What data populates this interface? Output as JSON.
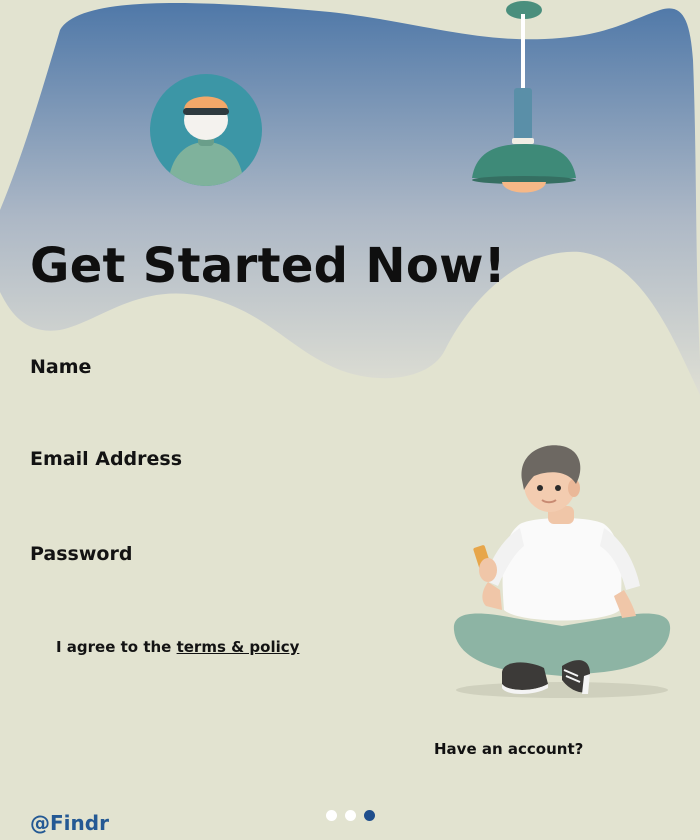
{
  "header": {
    "title": "Get Started Now!"
  },
  "form": {
    "name_label": "Name",
    "email_label": "Email Address",
    "password_label": "Password",
    "agree_prefix": "I agree to the ",
    "agree_link": "terms & policy"
  },
  "footer": {
    "have_account": "Have an account?",
    "brand": "@Findr",
    "pager": {
      "count": 3,
      "active_index": 2
    }
  },
  "illustrations": {
    "avatar": "user-avatar-icon",
    "lamp": "pendant-lamp-icon",
    "person": "person-with-phone-illustration"
  },
  "colors": {
    "background": "#e2e3d0",
    "gradient_top": "#4f78a8",
    "gradient_bottom": "#dfdfd4",
    "accent": "#1f4e8c",
    "brand": "#245994",
    "avatar_circle": "#3c96a6",
    "lamp_green": "#3e8a78",
    "pants": "#8db4a4"
  }
}
